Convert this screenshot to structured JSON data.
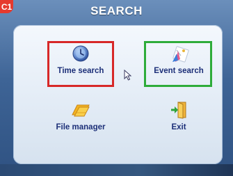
{
  "badge": "C1",
  "title": "SEARCH",
  "menu": {
    "items": [
      {
        "label": "Time search",
        "icon": "clock-icon"
      },
      {
        "label": "Event search",
        "icon": "event-icon"
      },
      {
        "label": "File manager",
        "icon": "folder-icon"
      },
      {
        "label": "Exit",
        "icon": "exit-door-icon"
      }
    ]
  },
  "highlights": {
    "time_search": "#d72828",
    "event_search": "#2eac3a"
  },
  "colors": {
    "label": "#1c2f78",
    "badge": "#e63a2e",
    "title_bar": "#3e6496"
  }
}
